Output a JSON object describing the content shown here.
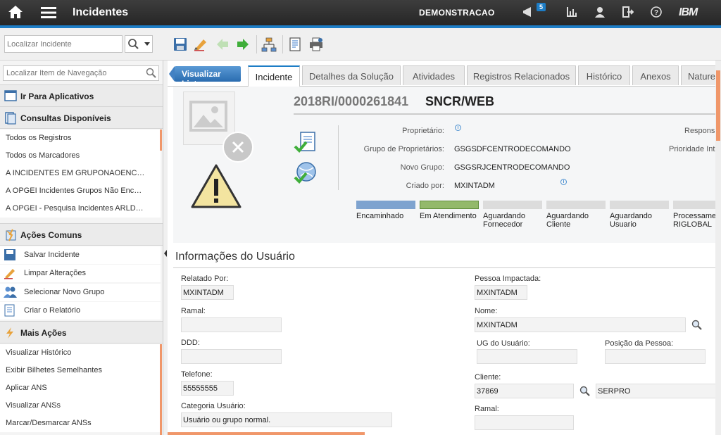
{
  "header": {
    "app_title": "Incidentes",
    "org": "DEMONSTRACAO",
    "notifications": "5",
    "brand": "IBM"
  },
  "toolbar": {
    "search_placeholder": "Localizar Incidente"
  },
  "nav": {
    "search_placeholder": "Localizar Item de Navegação",
    "go_to_apps": "Ir Para Aplicativos",
    "queries_title": "Consultas Disponíveis",
    "queries": [
      "Todos os Registros",
      "Todos os Marcadores",
      "A INCIDENTES EM GRUPONAOENC…",
      "A OPGEI Incidentes Grupos Não Enc…",
      "A OPGEI - Pesquisa Incidentes ARLD…"
    ],
    "common_title": "Ações Comuns",
    "common": [
      "Salvar Incidente",
      "Limpar Alterações",
      "Selecionar Novo Grupo",
      "Criar o Relatório"
    ],
    "more_title": "Mais Ações",
    "more": [
      "Visualizar Histórico",
      "Exibir Bilhetes Semelhantes",
      "Aplicar ANS",
      "Visualizar ANSs",
      "Marcar/Desmarcar ANSs"
    ]
  },
  "tabs": {
    "view_list": "Visualizar Lista",
    "items": [
      "Incidente",
      "Detalhes da Solução",
      "Atividades",
      "Registros Relacionados",
      "Histórico",
      "Anexos",
      "Nature"
    ]
  },
  "record": {
    "id": "2018RI/0000261841",
    "description": "SNCR/WEB",
    "owner_label": "Proprietário:",
    "owner_group_label": "Grupo de Proprietários:",
    "owner_group": "GSGSDFCENTRODECOMANDO",
    "new_group_label": "Novo Grupo:",
    "new_group": "GSGSRJCENTRODECOMANDO",
    "created_by_label": "Criado por:",
    "created_by": "MXINTADM",
    "responsible_label": "Respons",
    "priority_label": "Prioridade Int",
    "status_steps": [
      "Encaminhado",
      "Em Atendimento",
      "Aguardando Fornecedor",
      "Aguardando Cliente",
      "Aguardando Usuario",
      "Processame RIGLOBAL"
    ]
  },
  "user_info": {
    "title": "Informações do Usuário",
    "reported_by_label": "Relatado Por:",
    "reported_by": "MXINTADM",
    "extension_label": "Ramal:",
    "extension": "",
    "ddd_label": "DDD:",
    "ddd": "",
    "phone_label": "Telefone:",
    "phone": "55555555",
    "category_label": "Categoria Usuário:",
    "category": "Usuário ou grupo normal.",
    "affected_label": "Pessoa Impactada:",
    "affected": "MXINTADM",
    "name_label": "Nome:",
    "name": "MXINTADM",
    "ug_label": "UG do Usuário:",
    "ug": "",
    "position_label": "Posição da Pessoa:",
    "position": "",
    "client_label": "Cliente:",
    "client_id": "37869",
    "client_name": "SERPRO",
    "extension2_label": "Ramal:",
    "extension2": ""
  },
  "colors": {
    "accent": "#1d7dc6",
    "step_done": "#7ea3cf",
    "step_current": "#93b96b",
    "step_pending": "#dcdcdc",
    "scroll": "#f0976a"
  }
}
